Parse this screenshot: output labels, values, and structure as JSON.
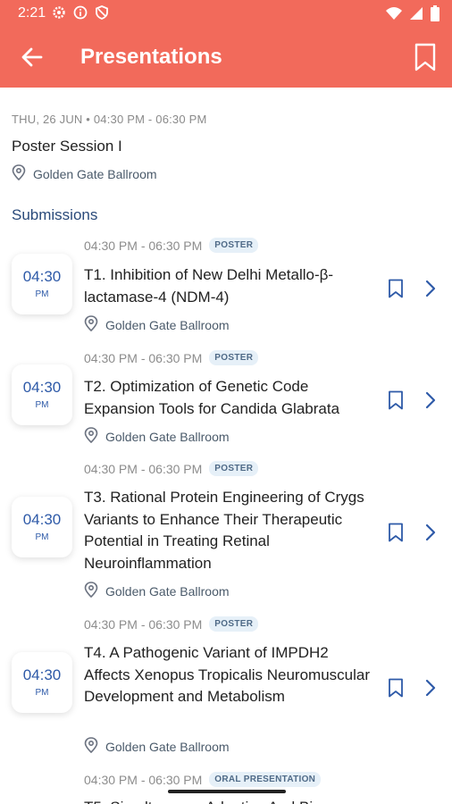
{
  "status_bar": {
    "time": "2:21"
  },
  "app_bar": {
    "title": "Presentations"
  },
  "session": {
    "datetime": "THU, 26 JUN • 04:30 PM - 06:30 PM",
    "title": "Poster Session I",
    "location": "Golden Gate Ballroom"
  },
  "submissions_label": "Submissions",
  "items": [
    {
      "time": "04:30",
      "ampm": "PM",
      "range": "04:30 PM - 06:30 PM",
      "type": "POSTER",
      "title": "T1. Inhibition of New Delhi Metallo-β-lactamase-4 (NDM-4)",
      "location": "Golden Gate Ballroom"
    },
    {
      "time": "04:30",
      "ampm": "PM",
      "range": "04:30 PM - 06:30 PM",
      "type": "POSTER",
      "title": "T2. Optimization of Genetic Code Expansion Tools for Candida Glabrata",
      "location": "Golden Gate Ballroom"
    },
    {
      "time": "04:30",
      "ampm": "PM",
      "range": "04:30 PM - 06:30 PM",
      "type": "POSTER",
      "title": "T3. Rational Protein Engineering of Crygs Variants to Enhance Their Therapeutic Potential in Treating Retinal Neuroinflammation",
      "location": "Golden Gate Ballroom"
    },
    {
      "time": "04:30",
      "ampm": "PM",
      "range": "04:30 PM - 06:30 PM",
      "type": "POSTER",
      "title": "T4. A Pathogenic Variant of IMPDH2 Affects Xenopus Tropicalis Neuromuscular Development and Metabolism",
      "location": "Golden Gate Ballroom"
    },
    {
      "time": "04:30",
      "ampm": "PM",
      "range": "04:30 PM - 06:30 PM",
      "type": "ORAL PRESENTATION",
      "title": "T5. Simultaneous Adaptive And Bi",
      "location": ""
    }
  ],
  "colors": {
    "brand": "#f26a5b",
    "accent": "#2e5aa8"
  },
  "icons": [
    "settings-icon",
    "info-icon",
    "shield-icon",
    "wifi-icon",
    "signal-icon",
    "battery-icon",
    "back-arrow-icon",
    "bookmark-icon",
    "location-pin-icon",
    "chevron-right-icon"
  ]
}
